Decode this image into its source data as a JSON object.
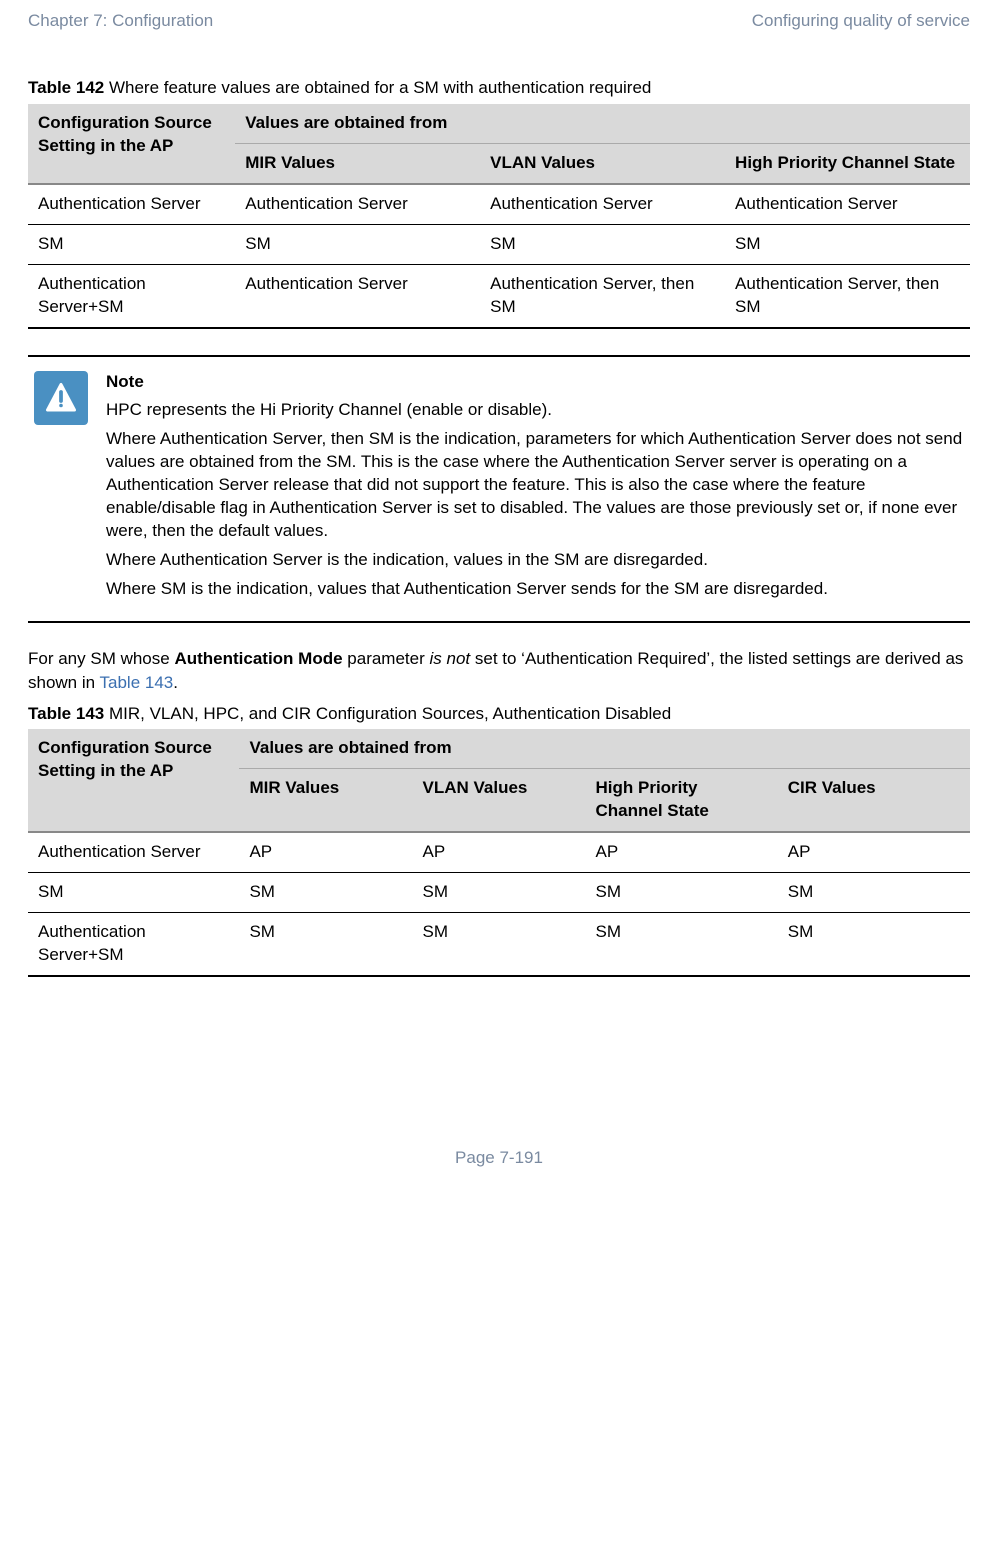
{
  "header": {
    "left": "Chapter 7:  Configuration",
    "right": "Configuring quality of service"
  },
  "table142": {
    "caption_prefix": "Table 142",
    "caption_rest": " Where feature values are obtained for a SM with authentication required",
    "col1_header": "Configuration Source Setting in the AP",
    "group_header": "Values are obtained from",
    "sub_headers": [
      "MIR Values",
      "VLAN Values",
      "High Priority Channel State"
    ],
    "rows": [
      [
        "Authentication Server",
        "Authentication Server",
        "Authentication Server",
        "Authentication Server"
      ],
      [
        "SM",
        "SM",
        "SM",
        "SM"
      ],
      [
        "Authentication Server+SM",
        "Authentication Server",
        "Authentication Server, then SM",
        "Authentication Server, then SM"
      ]
    ]
  },
  "note": {
    "title": "Note",
    "p1": "HPC represents the Hi Priority Channel (enable or disable).",
    "p2": "Where Authentication Server, then SM is the indication, parameters for which Authentication Server does not send values are obtained from the SM. This is the case where the Authentication Server server is operating on a Authentication Server release that did not support the feature. This is also the case where the feature enable/disable flag in Authentication Server is set to disabled. The values are those previously set or, if none ever were, then the default values.",
    "p3": "Where Authentication Server is the indication, values in the SM are disregarded.",
    "p4": "Where SM is the indication, values that Authentication Server sends for the SM are disregarded."
  },
  "para": {
    "pre": "For any SM whose ",
    "strong": "Authentication Mode",
    "mid1": " parameter ",
    "em": "is not",
    "mid2": " set to ‘Authentication Required’, the listed settings are derived as shown in ",
    "link": "Table 143",
    "post": "."
  },
  "table143": {
    "caption_prefix": "Table 143",
    "caption_rest": " MIR, VLAN, HPC, and CIR Configuration Sources, Authentication Disabled",
    "col1_header": "Configuration Source Setting in the AP",
    "group_header": "Values are obtained from",
    "sub_headers": [
      "MIR Values",
      "VLAN Values",
      "High Priority Channel State",
      "CIR Values"
    ],
    "rows": [
      [
        "Authentication Server",
        "AP",
        "AP",
        "AP",
        "AP"
      ],
      [
        "SM",
        "SM",
        "SM",
        "SM",
        "SM"
      ],
      [
        "Authentication Server+SM",
        "SM",
        "SM",
        "SM",
        "SM"
      ]
    ]
  },
  "footer": "Page 7-191"
}
